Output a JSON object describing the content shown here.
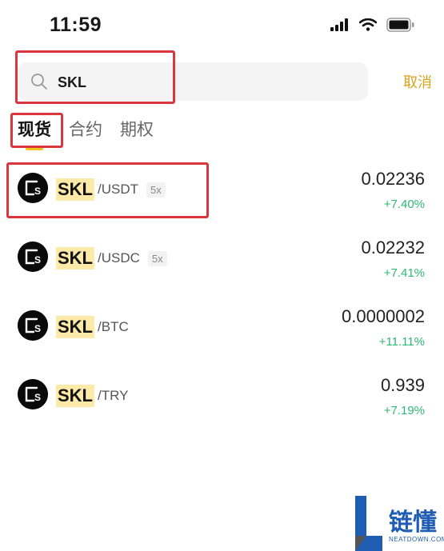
{
  "status_bar": {
    "time": "11:59"
  },
  "search": {
    "value": "SKL",
    "placeholder": "",
    "cancel_label": "取消"
  },
  "tabs": [
    {
      "label": "现货",
      "active": true
    },
    {
      "label": "合约",
      "active": false
    },
    {
      "label": "期权",
      "active": false
    }
  ],
  "pairs": [
    {
      "base": "SKL",
      "quote": "/USDT",
      "leverage": "5x",
      "price": "0.02236",
      "change": "+7.40%"
    },
    {
      "base": "SKL",
      "quote": "/USDC",
      "leverage": "5x",
      "price": "0.02232",
      "change": "+7.41%"
    },
    {
      "base": "SKL",
      "quote": "/BTC",
      "leverage": "",
      "price": "0.0000002",
      "change": "+11.11%"
    },
    {
      "base": "SKL",
      "quote": "/TRY",
      "leverage": "",
      "price": "0.939",
      "change": "+7.19%"
    }
  ],
  "watermark": {
    "title": "链懂",
    "subtitle": "NEATDOWN.COM"
  },
  "colors": {
    "accent": "#d9a31a",
    "positive": "#2eb875",
    "highlight": "#fde9a8",
    "annotation": "#d9363e"
  },
  "icons": [
    "signal-icon",
    "wifi-icon",
    "battery-icon",
    "search-icon",
    "skl-coin-icon"
  ]
}
